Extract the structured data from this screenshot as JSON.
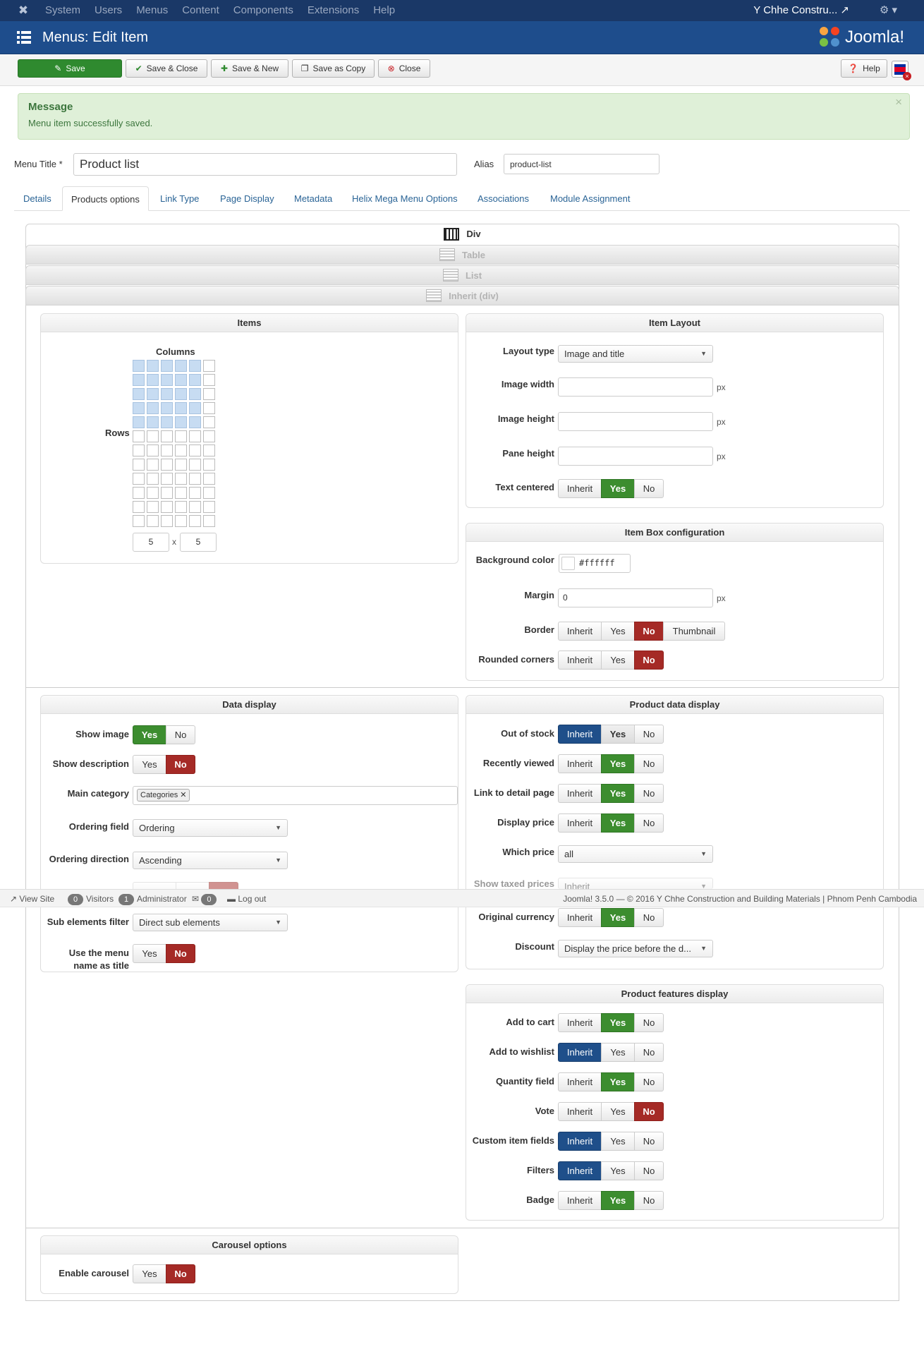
{
  "topnav": {
    "menu": [
      "System",
      "Users",
      "Menus",
      "Content",
      "Components",
      "Extensions",
      "Help"
    ],
    "site_name": "Y Chhe Constru...",
    "icons": [
      "joomla-icon",
      "external-link-icon",
      "gear-icon"
    ]
  },
  "header": {
    "title": "Menus: Edit Item",
    "brand": "Joomla!"
  },
  "toolbar": {
    "save": "Save",
    "save_close": "Save & Close",
    "save_new": "Save & New",
    "save_copy": "Save as Copy",
    "close": "Close",
    "help": "Help"
  },
  "message": {
    "heading": "Message",
    "text": "Menu item successfully saved.",
    "close": "×"
  },
  "form": {
    "menu_title_label": "Menu Title *",
    "menu_title_value": "Product list",
    "alias_label": "Alias",
    "alias_value": "product-list"
  },
  "tabs": [
    "Details",
    "Products options",
    "Link Type",
    "Page Display",
    "Metadata",
    "Helix Mega Menu Options",
    "Associations",
    "Module Assignment"
  ],
  "active_tab": "Products options",
  "layout_options": [
    "Div",
    "Table",
    "List",
    "Inherit (div)"
  ],
  "selected_layout": "Div",
  "items_panel": {
    "title": "Items",
    "columns_label": "Columns",
    "rows_label": "Rows",
    "columns": "5",
    "rows": "5",
    "x": "x"
  },
  "item_layout": {
    "title": "Item Layout",
    "layout_type_label": "Layout type",
    "layout_type_value": "Image and title",
    "image_width_label": "Image width",
    "image_height_label": "Image height",
    "pane_height_label": "Pane height",
    "unit": "px",
    "text_centered_label": "Text centered",
    "options3": [
      "Inherit",
      "Yes",
      "No"
    ]
  },
  "item_box": {
    "title": "Item Box configuration",
    "bg_label": "Background color",
    "bg_value": "#ffffff",
    "margin_label": "Margin",
    "margin_value": "0",
    "border_label": "Border",
    "border_options": [
      "Inherit",
      "Yes",
      "No",
      "Thumbnail"
    ],
    "rounded_label": "Rounded corners"
  },
  "data_display": {
    "title": "Data display",
    "show_image": "Show image",
    "show_description": "Show description",
    "main_category": "Main category",
    "category_tag": "Categories",
    "ordering_field": "Ordering field",
    "ordering_field_value": "Ordering",
    "ordering_direction": "Ordering direction",
    "ordering_direction_value": "Ascending",
    "sub_filter": "Sub elements filter",
    "sub_filter_value": "Direct sub elements",
    "menu_name_title_1": "Use the menu",
    "menu_name_title_2": "name as title",
    "yes": "Yes",
    "no": "No"
  },
  "product_data": {
    "title": "Product data display",
    "out_of_stock": "Out of stock",
    "recently_viewed": "Recently viewed",
    "link_detail": "Link to detail page",
    "display_price": "Display price",
    "which_price": "Which price",
    "which_price_value": "all",
    "show_taxed": "Show taxed prices",
    "show_taxed_value": "Inherit",
    "original_currency": "Original currency",
    "discount": "Discount",
    "discount_value": "Display the price before the d..."
  },
  "features": {
    "title": "Product features display",
    "add_to_cart": "Add to cart",
    "add_to_wishlist": "Add to wishlist",
    "quantity": "Quantity field",
    "vote": "Vote",
    "custom_fields": "Custom item fields",
    "filters": "Filters",
    "badge": "Badge"
  },
  "carousel": {
    "title": "Carousel options",
    "enable": "Enable carousel"
  },
  "statusbar": {
    "view_site": "View Site",
    "visitors_count": "0",
    "visitors": "Visitors",
    "admin_count": "1",
    "admin": "Administrator",
    "mail_count": "0",
    "logout": "Log out",
    "version": "Joomla! 3.5.0 — © 2016 Y Chhe Construction and Building Materials | Phnom Penh Cambodia"
  },
  "colors": {
    "nav": "#1a3867",
    "header": "#1e4d8c",
    "green": "#3c8d2f",
    "red": "#a52a26",
    "blue": "#1f4f8a",
    "grid_on": "#c7dcf2"
  }
}
